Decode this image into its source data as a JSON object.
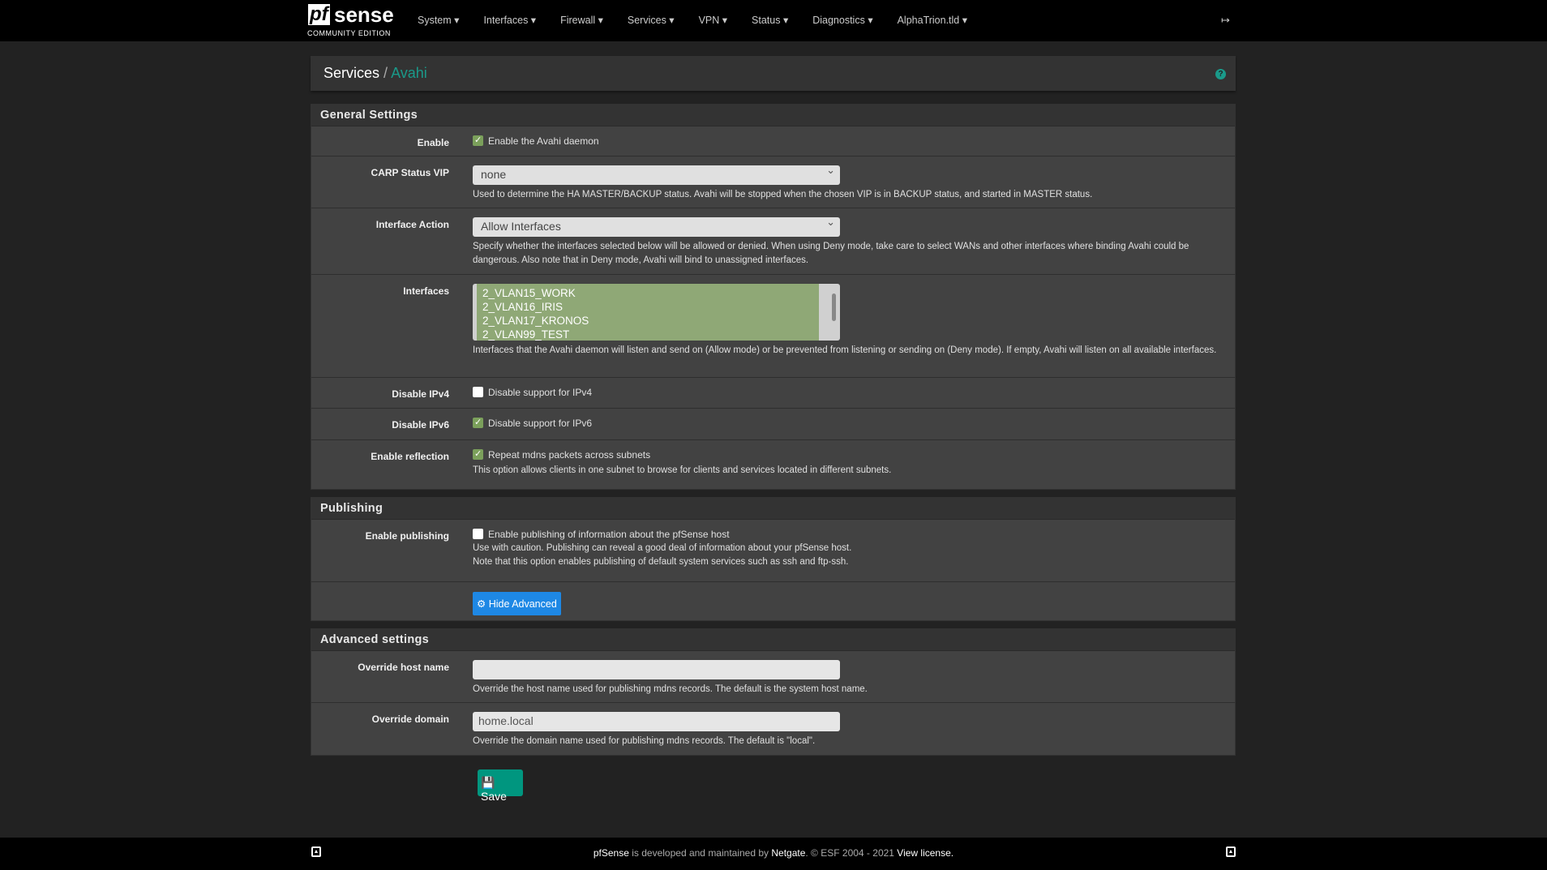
{
  "nav": {
    "logo_mark": "pf",
    "logo_word": "sense",
    "logo_sub": "COMMUNITY EDITION",
    "menu": [
      "System",
      "Interfaces",
      "Firewall",
      "Services",
      "VPN",
      "Status",
      "Diagnostics",
      "AlphaTrion.tld"
    ],
    "logout_icon": "sign-out-icon"
  },
  "breadcrumb": {
    "parent": "Services",
    "sep": "/",
    "current": "Avahi",
    "help_icon": "question-circle-icon"
  },
  "general": {
    "title": "General Settings",
    "enable": {
      "label": "Enable",
      "checked": true,
      "text": "Enable the Avahi daemon"
    },
    "carp": {
      "label": "CARP Status VIP",
      "value": "none",
      "help": "Used to determine the HA MASTER/BACKUP status. Avahi will be stopped when the chosen VIP is in BACKUP status, and started in MASTER status."
    },
    "action": {
      "label": "Interface Action",
      "value": "Allow Interfaces",
      "help": "Specify whether the interfaces selected below will be allowed or denied. When using Deny mode, take care to select WANs and other interfaces where binding Avahi could be dangerous. Also note that in Deny mode, Avahi will bind to unassigned interfaces."
    },
    "interfaces": {
      "label": "Interfaces",
      "items": [
        "2_VLAN15_WORK",
        "2_VLAN16_IRIS",
        "2_VLAN17_KRONOS",
        "2_VLAN99_TEST"
      ],
      "help": "Interfaces that the Avahi daemon will listen and send on (Allow mode) or be prevented from listening or sending on (Deny mode). If empty, Avahi will listen on all available interfaces."
    },
    "ipv4": {
      "label": "Disable IPv4",
      "checked": false,
      "text": "Disable support for IPv4"
    },
    "ipv6": {
      "label": "Disable IPv6",
      "checked": true,
      "text": "Disable support for IPv6"
    },
    "reflection": {
      "label": "Enable reflection",
      "checked": true,
      "text": "Repeat mdns packets across subnets",
      "help": "This option allows clients in one subnet to browse for clients and services located in different subnets."
    }
  },
  "publishing": {
    "title": "Publishing",
    "enable": {
      "label": "Enable publishing",
      "checked": false,
      "text": "Enable publishing of information about the pfSense host",
      "help1": "Use with caution. Publishing can reveal a good deal of information about your pfSense host.",
      "help2": "Note that this option enables publishing of default system services such as ssh and ftp-ssh."
    },
    "advanced_button": "Hide Advanced"
  },
  "advanced": {
    "title": "Advanced settings",
    "host": {
      "label": "Override host name",
      "value": "",
      "help": "Override the host name used for publishing mdns records. The default is the system host name."
    },
    "domain": {
      "label": "Override domain",
      "value": "home.local",
      "help": "Override the domain name used for publishing mdns records. The default is \"local\"."
    }
  },
  "save_label": "Save",
  "footer": {
    "a": "pfSense",
    "b": " is developed and maintained by ",
    "c": "Netgate",
    "d": ". © ESF 2004 - 2021 ",
    "e": "View license."
  }
}
